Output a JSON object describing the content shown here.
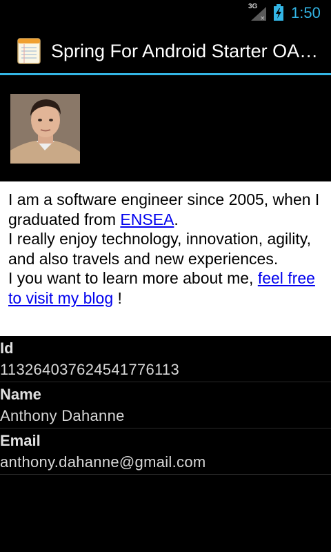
{
  "status_bar": {
    "network_type": "3G",
    "time": "1:50",
    "accent_color": "#33b5e5"
  },
  "action_bar": {
    "icon": "notepad-icon",
    "title": "Spring For Android Starter OAuth"
  },
  "profile": {
    "avatar": "profile-photo"
  },
  "bio": {
    "line1": "I am a software engineer since 2005, when I graduated from ",
    "ensea_link": "ENSEA",
    "line1_end": ".",
    "line2": "I really enjoy technology, innovation, agility, and also travels and new experiences.",
    "line3": "I you want to learn more about me, ",
    "blog_link": "feel free to visit my blog",
    "line3_end": " !"
  },
  "fields": {
    "id_label": "Id",
    "id_value": "113264037624541776113",
    "name_label": "Name",
    "name_value": "Anthony Dahanne",
    "email_label": "Email",
    "email_value": "anthony.dahanne@gmail.com"
  }
}
